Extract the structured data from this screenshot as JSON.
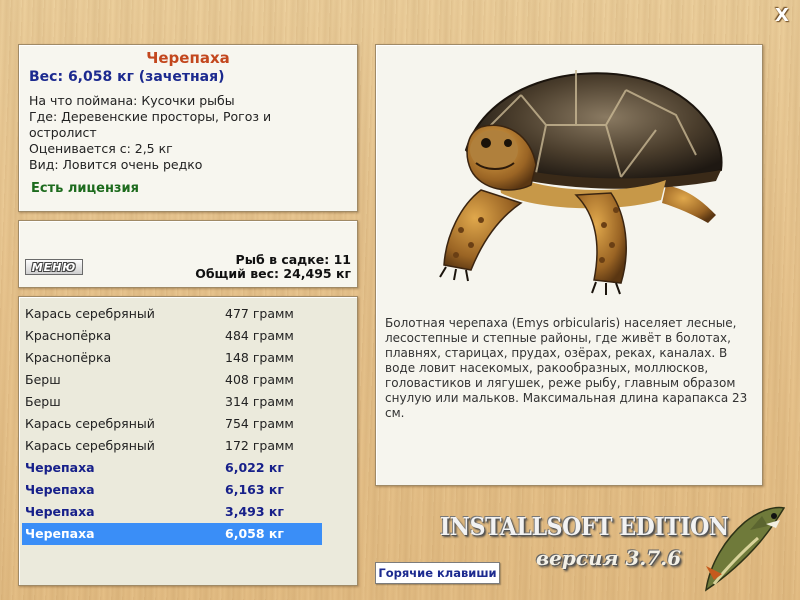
{
  "close_label": "X",
  "info": {
    "name": "Черепаха",
    "weight_line": "Вес: 6,058 кг (зачетная)",
    "bait_line": "На что поймана: Кусочки рыбы",
    "place_line": "Где: Деревенские просторы, Рогоз и",
    "place_line2": "остролист",
    "min_line": "Оценивается с: 2,5 кг",
    "rarity_line": "Вид: Ловится очень редко",
    "license": "Есть лицензия"
  },
  "keep": {
    "menu_label": "МЕНЮ",
    "count_line": "Рыб в садке: 11",
    "total_line": "Общий вес: 24,495 кг"
  },
  "catch_list": [
    {
      "name": "Карась серебряный",
      "weight": "477 грамм",
      "state": "normal"
    },
    {
      "name": "Краснопёрка",
      "weight": "484 грамм",
      "state": "normal"
    },
    {
      "name": "Краснопёрка",
      "weight": "148 грамм",
      "state": "normal"
    },
    {
      "name": "Берш",
      "weight": "408 грамм",
      "state": "normal"
    },
    {
      "name": "Берш",
      "weight": "314 грамм",
      "state": "normal"
    },
    {
      "name": "Карась серебряный",
      "weight": "754 грамм",
      "state": "normal"
    },
    {
      "name": "Карась серебряный",
      "weight": "172 грамм",
      "state": "normal"
    },
    {
      "name": "Черепаха",
      "weight": "6,022 кг",
      "state": "caught"
    },
    {
      "name": "Черепаха",
      "weight": "6,163 кг",
      "state": "caught"
    },
    {
      "name": "Черепаха",
      "weight": "3,493 кг",
      "state": "caught"
    },
    {
      "name": "Черепаха",
      "weight": "6,058 кг",
      "state": "selected"
    }
  ],
  "description": "Болотная черепаха (Emys orbicularis) населяет лесные, лесостепные и степные районы, где живёт в болотах, плавнях, старицах, прудах, озёрах, реках, каналах. В воде ловит насекомых, ракообразных, моллюсков, головастиков и лягушек, реже рыбу, главным образом снулую или мальков. Максимальная длина карапакса 23 см.",
  "brand": {
    "title": "INSTALLSOFT EDITION",
    "version": "версия 3.7.6"
  },
  "hotkeys_label": "Горячие клавиши",
  "icons": {
    "close": "close-icon",
    "fish_image": "turtle-image",
    "logo": "pike-logo-icon"
  },
  "colors": {
    "title_orange": "#c3471e",
    "accent_blue": "#1c2a8f",
    "license_green": "#1d6b1d",
    "selection": "#3a8ef7"
  }
}
